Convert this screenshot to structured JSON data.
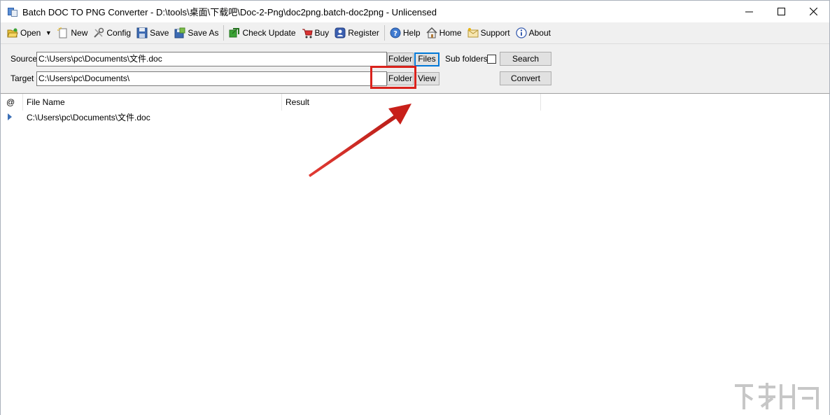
{
  "window": {
    "title": "Batch DOC TO PNG Converter - D:\\tools\\桌面\\下载吧\\Doc-2-Png\\doc2png.batch-doc2png - Unlicensed",
    "minimize": "—",
    "maximize": "☐",
    "close": "✕"
  },
  "toolbar": {
    "open": "Open",
    "new": "New",
    "config": "Config",
    "save": "Save",
    "save_as": "Save As",
    "check_update": "Check Update",
    "buy": "Buy",
    "register": "Register",
    "help": "Help",
    "home": "Home",
    "support": "Support",
    "about": "About"
  },
  "source": {
    "label": "Source",
    "value": "C:\\Users\\pc\\Documents\\文件.doc",
    "folder_btn": "Folder",
    "files_btn": "Files",
    "subfolders_label": "Sub folders",
    "search_btn": "Search"
  },
  "target": {
    "label": "Target",
    "value": "C:\\Users\\pc\\Documents\\",
    "folder_btn": "Folder",
    "view_btn": "View",
    "convert_btn": "Convert"
  },
  "list": {
    "columns": [
      "@",
      "File Name",
      "Result"
    ],
    "rows": [
      {
        "file": "C:\\Users\\pc\\Documents\\文件.doc",
        "result": ""
      }
    ]
  },
  "colors": {
    "annotation": "#d9221c",
    "accent": "#0078d7"
  },
  "icons": {
    "open": "folder-open-icon",
    "new": "new-doc-icon",
    "config": "tools-icon",
    "save": "floppy-icon",
    "save_as": "floppy-as-icon",
    "check_update": "update-icon",
    "buy": "cart-icon",
    "register": "key-icon",
    "help": "help-icon",
    "home": "home-icon",
    "support": "support-icon",
    "about": "info-icon"
  }
}
